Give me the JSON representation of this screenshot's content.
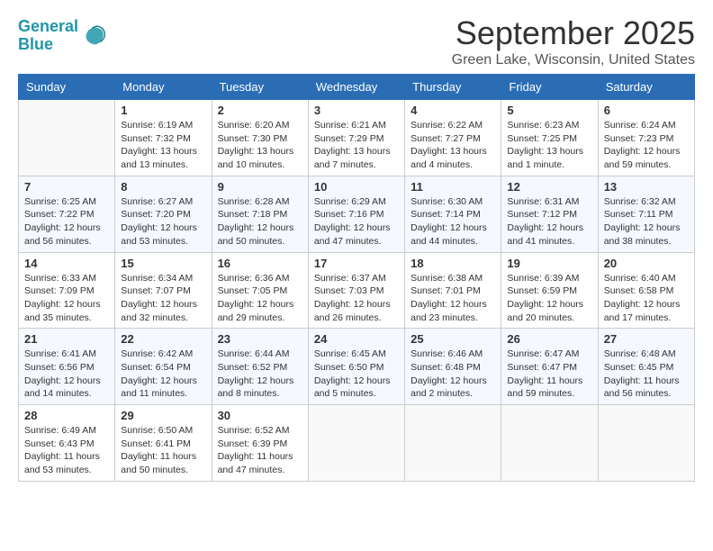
{
  "logo": {
    "text_general": "General",
    "text_blue": "Blue"
  },
  "title": "September 2025",
  "location": "Green Lake, Wisconsin, United States",
  "days_of_week": [
    "Sunday",
    "Monday",
    "Tuesday",
    "Wednesday",
    "Thursday",
    "Friday",
    "Saturday"
  ],
  "weeks": [
    [
      {
        "day": "",
        "empty": true
      },
      {
        "day": "1",
        "sunrise": "6:19 AM",
        "sunset": "7:32 PM",
        "daylight": "13 hours and 13 minutes."
      },
      {
        "day": "2",
        "sunrise": "6:20 AM",
        "sunset": "7:30 PM",
        "daylight": "13 hours and 10 minutes."
      },
      {
        "day": "3",
        "sunrise": "6:21 AM",
        "sunset": "7:29 PM",
        "daylight": "13 hours and 7 minutes."
      },
      {
        "day": "4",
        "sunrise": "6:22 AM",
        "sunset": "7:27 PM",
        "daylight": "13 hours and 4 minutes."
      },
      {
        "day": "5",
        "sunrise": "6:23 AM",
        "sunset": "7:25 PM",
        "daylight": "13 hours and 1 minute."
      },
      {
        "day": "6",
        "sunrise": "6:24 AM",
        "sunset": "7:23 PM",
        "daylight": "12 hours and 59 minutes."
      }
    ],
    [
      {
        "day": "7",
        "sunrise": "6:25 AM",
        "sunset": "7:22 PM",
        "daylight": "12 hours and 56 minutes."
      },
      {
        "day": "8",
        "sunrise": "6:27 AM",
        "sunset": "7:20 PM",
        "daylight": "12 hours and 53 minutes."
      },
      {
        "day": "9",
        "sunrise": "6:28 AM",
        "sunset": "7:18 PM",
        "daylight": "12 hours and 50 minutes."
      },
      {
        "day": "10",
        "sunrise": "6:29 AM",
        "sunset": "7:16 PM",
        "daylight": "12 hours and 47 minutes."
      },
      {
        "day": "11",
        "sunrise": "6:30 AM",
        "sunset": "7:14 PM",
        "daylight": "12 hours and 44 minutes."
      },
      {
        "day": "12",
        "sunrise": "6:31 AM",
        "sunset": "7:12 PM",
        "daylight": "12 hours and 41 minutes."
      },
      {
        "day": "13",
        "sunrise": "6:32 AM",
        "sunset": "7:11 PM",
        "daylight": "12 hours and 38 minutes."
      }
    ],
    [
      {
        "day": "14",
        "sunrise": "6:33 AM",
        "sunset": "7:09 PM",
        "daylight": "12 hours and 35 minutes."
      },
      {
        "day": "15",
        "sunrise": "6:34 AM",
        "sunset": "7:07 PM",
        "daylight": "12 hours and 32 minutes."
      },
      {
        "day": "16",
        "sunrise": "6:36 AM",
        "sunset": "7:05 PM",
        "daylight": "12 hours and 29 minutes."
      },
      {
        "day": "17",
        "sunrise": "6:37 AM",
        "sunset": "7:03 PM",
        "daylight": "12 hours and 26 minutes."
      },
      {
        "day": "18",
        "sunrise": "6:38 AM",
        "sunset": "7:01 PM",
        "daylight": "12 hours and 23 minutes."
      },
      {
        "day": "19",
        "sunrise": "6:39 AM",
        "sunset": "6:59 PM",
        "daylight": "12 hours and 20 minutes."
      },
      {
        "day": "20",
        "sunrise": "6:40 AM",
        "sunset": "6:58 PM",
        "daylight": "12 hours and 17 minutes."
      }
    ],
    [
      {
        "day": "21",
        "sunrise": "6:41 AM",
        "sunset": "6:56 PM",
        "daylight": "12 hours and 14 minutes."
      },
      {
        "day": "22",
        "sunrise": "6:42 AM",
        "sunset": "6:54 PM",
        "daylight": "12 hours and 11 minutes."
      },
      {
        "day": "23",
        "sunrise": "6:44 AM",
        "sunset": "6:52 PM",
        "daylight": "12 hours and 8 minutes."
      },
      {
        "day": "24",
        "sunrise": "6:45 AM",
        "sunset": "6:50 PM",
        "daylight": "12 hours and 5 minutes."
      },
      {
        "day": "25",
        "sunrise": "6:46 AM",
        "sunset": "6:48 PM",
        "daylight": "12 hours and 2 minutes."
      },
      {
        "day": "26",
        "sunrise": "6:47 AM",
        "sunset": "6:47 PM",
        "daylight": "11 hours and 59 minutes."
      },
      {
        "day": "27",
        "sunrise": "6:48 AM",
        "sunset": "6:45 PM",
        "daylight": "11 hours and 56 minutes."
      }
    ],
    [
      {
        "day": "28",
        "sunrise": "6:49 AM",
        "sunset": "6:43 PM",
        "daylight": "11 hours and 53 minutes."
      },
      {
        "day": "29",
        "sunrise": "6:50 AM",
        "sunset": "6:41 PM",
        "daylight": "11 hours and 50 minutes."
      },
      {
        "day": "30",
        "sunrise": "6:52 AM",
        "sunset": "6:39 PM",
        "daylight": "11 hours and 47 minutes."
      },
      {
        "day": "",
        "empty": true
      },
      {
        "day": "",
        "empty": true
      },
      {
        "day": "",
        "empty": true
      },
      {
        "day": "",
        "empty": true
      }
    ]
  ],
  "labels": {
    "sunrise": "Sunrise:",
    "sunset": "Sunset:",
    "daylight": "Daylight:"
  }
}
